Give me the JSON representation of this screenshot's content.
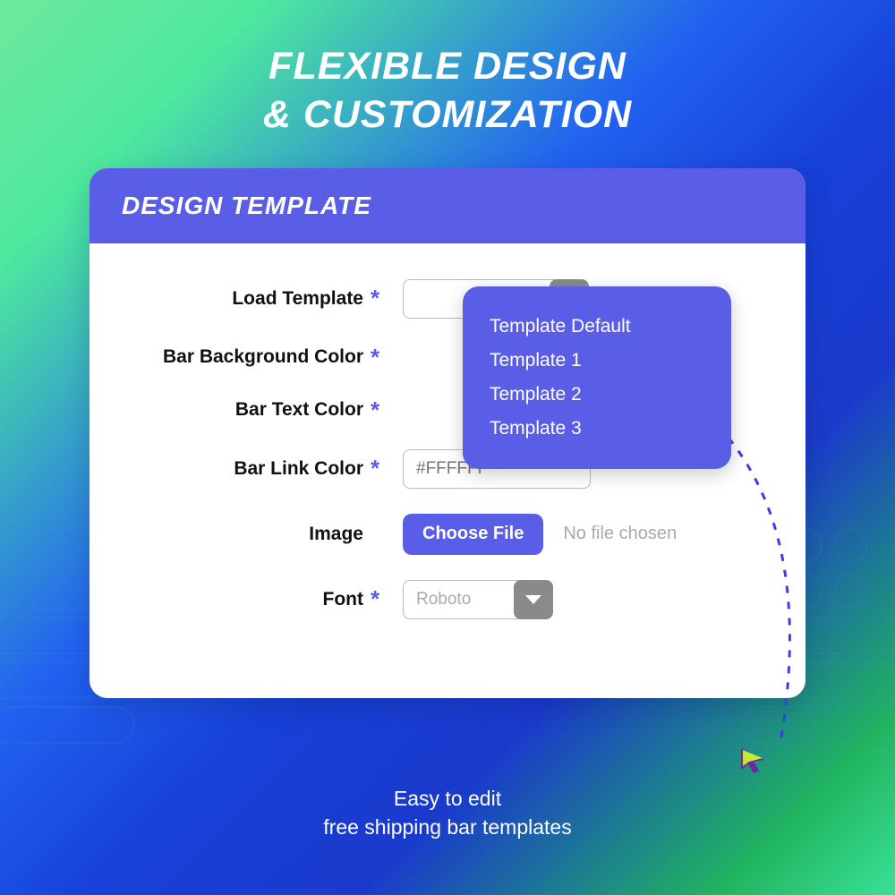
{
  "heading": {
    "line1": "FLEXIBLE DESIGN",
    "line2": "& CUSTOMIZATION"
  },
  "card": {
    "title": "DESIGN TEMPLATE",
    "fields": {
      "load_template": {
        "label": "Load Template",
        "value": ""
      },
      "bar_bg_color": {
        "label": "Bar Background Color"
      },
      "bar_text_color": {
        "label": "Bar Text Color"
      },
      "bar_link_color": {
        "label": "Bar Link Color",
        "placeholder": "#FFFFFF"
      },
      "image": {
        "label": "Image",
        "button": "Choose File",
        "status": "No file chosen"
      },
      "font": {
        "label": "Font",
        "value": "Roboto"
      }
    },
    "dropdown_options": [
      "Template Default",
      "Template 1",
      "Template 2",
      "Template 3"
    ]
  },
  "caption": {
    "line1": "Easy to edit",
    "line2": "free shipping bar templates"
  }
}
